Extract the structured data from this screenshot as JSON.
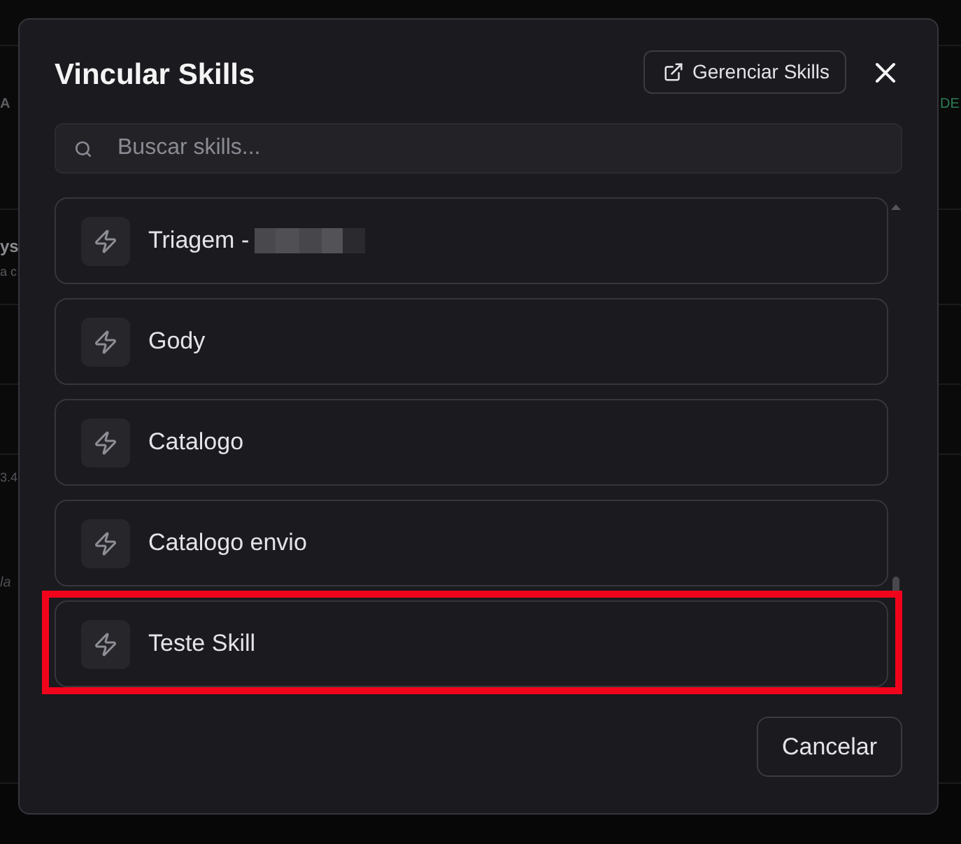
{
  "background": {
    "rows": [
      {
        "left": [
          {
            "text": "A",
            "kind": "label"
          }
        ],
        "right": [
          {
            "text": "DE",
            "kind": "status"
          }
        ]
      },
      {
        "left": [
          {
            "text": "ys",
            "kind": "name"
          },
          {
            "text": "a c",
            "kind": "caption"
          }
        ]
      },
      {
        "left": [
          {
            "text": "3.4",
            "kind": "value"
          },
          {
            "text": "la",
            "kind": "note"
          }
        ]
      }
    ]
  },
  "dialog": {
    "title": "Vincular Skills",
    "manage_button": "Gerenciar Skills",
    "search": {
      "placeholder": "Buscar skills..."
    },
    "skills": [
      {
        "label": "Triagem -",
        "redacted": true,
        "highlighted": false
      },
      {
        "label": "Gody",
        "redacted": false,
        "highlighted": false
      },
      {
        "label": "Catalogo",
        "redacted": false,
        "highlighted": false
      },
      {
        "label": "Catalogo envio",
        "redacted": false,
        "highlighted": false
      },
      {
        "label": "Teste Skill",
        "redacted": false,
        "highlighted": true
      }
    ],
    "buttons": [
      "Cancelar"
    ]
  }
}
